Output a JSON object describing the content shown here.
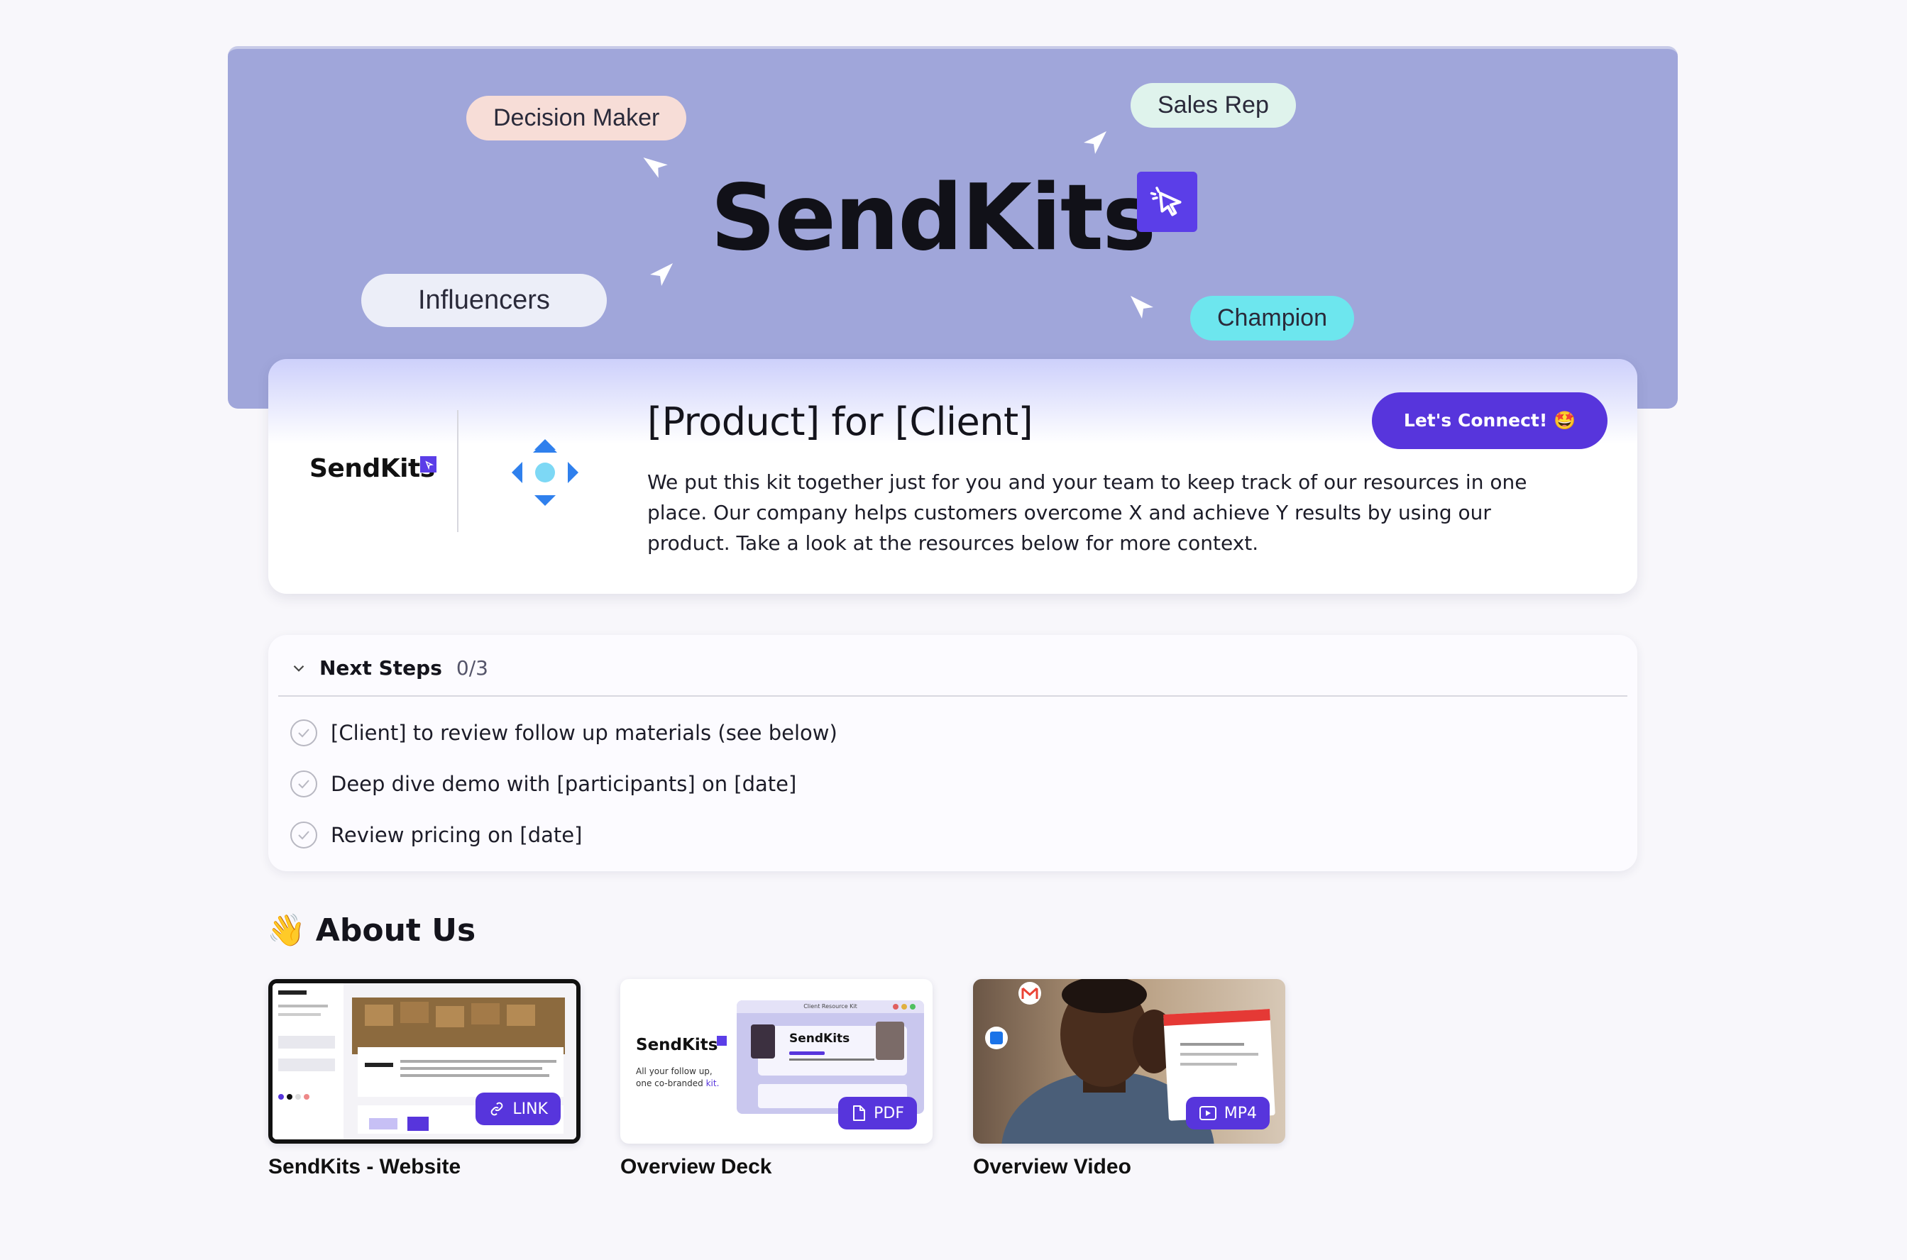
{
  "banner": {
    "title": "SendKits",
    "tags": {
      "decision_maker": "Decision Maker",
      "sales_rep": "Sales Rep",
      "influencers": "Influencers",
      "champion": "Champion"
    }
  },
  "header": {
    "brand": "SendKits",
    "title": "[Product] for [Client]",
    "description": "We put this kit together just for you and your team to keep track of our resources in one place. Our company helps customers overcome X and achieve Y results by using our product. Take a look at the resources below for more context.",
    "connect_label": "Let's Connect! 🤩"
  },
  "next_steps": {
    "title": "Next Steps",
    "count": "0/3",
    "items": [
      "[Client] to review follow up materials (see below)",
      "Deep dive demo with [participants] on [date]",
      "Review pricing on [date]"
    ]
  },
  "about": {
    "emoji": "👋",
    "title": "About Us",
    "resources": [
      {
        "caption": "SendKits - Website",
        "badge": "LINK"
      },
      {
        "caption": "Overview Deck",
        "badge": "PDF",
        "thumb_brand": "SendKits",
        "thumb_tagline_1": "All your follow up,",
        "thumb_tagline_2": "one co-branded ",
        "thumb_tagline_3": "kit.",
        "thumb_header": "Client Resource Kit"
      },
      {
        "caption": "Overview Video",
        "badge": "MP4"
      }
    ]
  },
  "colors": {
    "accent": "#5735dc",
    "banner_bg": "#a0a6da",
    "champion_tag": "#6de6ee"
  }
}
